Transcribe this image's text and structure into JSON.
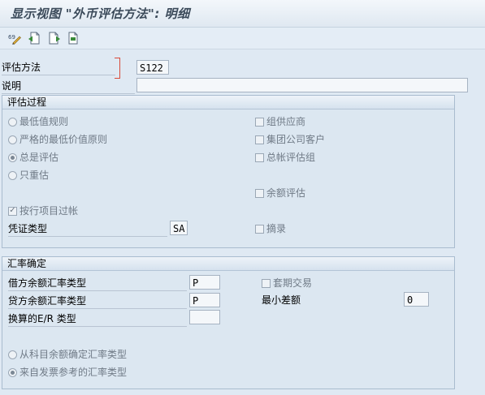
{
  "window": {
    "title": "显示视图 \"外币评估方法\": 明细"
  },
  "toolbar": {
    "buttons": [
      {
        "name": "display-change-icon"
      },
      {
        "name": "previous-entry-icon"
      },
      {
        "name": "next-entry-icon"
      },
      {
        "name": "other-entry-icon"
      }
    ]
  },
  "header": {
    "method_label": "评估方法",
    "method_value": "S122",
    "desc_label": "说明",
    "desc_value": ""
  },
  "valuation": {
    "title": "评估过程",
    "radios": [
      {
        "label": "最低值规则",
        "selected": false
      },
      {
        "label": "严格的最低价值原则",
        "selected": false
      },
      {
        "label": "总是评估",
        "selected": true
      },
      {
        "label": "只重估",
        "selected": false
      }
    ],
    "checks_right": [
      {
        "label": "组供应商",
        "checked": false
      },
      {
        "label": "集团公司客户",
        "checked": false
      },
      {
        "label": "总帐评估组",
        "checked": false
      },
      {
        "label": "余额评估",
        "checked": false
      }
    ],
    "line_item_post": {
      "label": "按行项目过帐",
      "checked": true
    },
    "doc_type_label": "凭证类型",
    "doc_type_value": "SA",
    "summary": {
      "label": "摘录",
      "checked": false
    }
  },
  "exchange": {
    "title": "汇率确定",
    "debit_label": "借方余额汇率类型",
    "debit_value": "P",
    "credit_label": "贷方余额汇率类型",
    "credit_value": "P",
    "er_label": "换算的E/R 类型",
    "er_value": "",
    "hedge": {
      "label": "套期交易",
      "checked": false
    },
    "min_diff_label": "最小差额",
    "min_diff_value": "0",
    "radios": [
      {
        "label": "从科目余额确定汇率类型",
        "selected": false
      },
      {
        "label": "来自发票参考的汇率类型",
        "selected": true
      }
    ]
  }
}
